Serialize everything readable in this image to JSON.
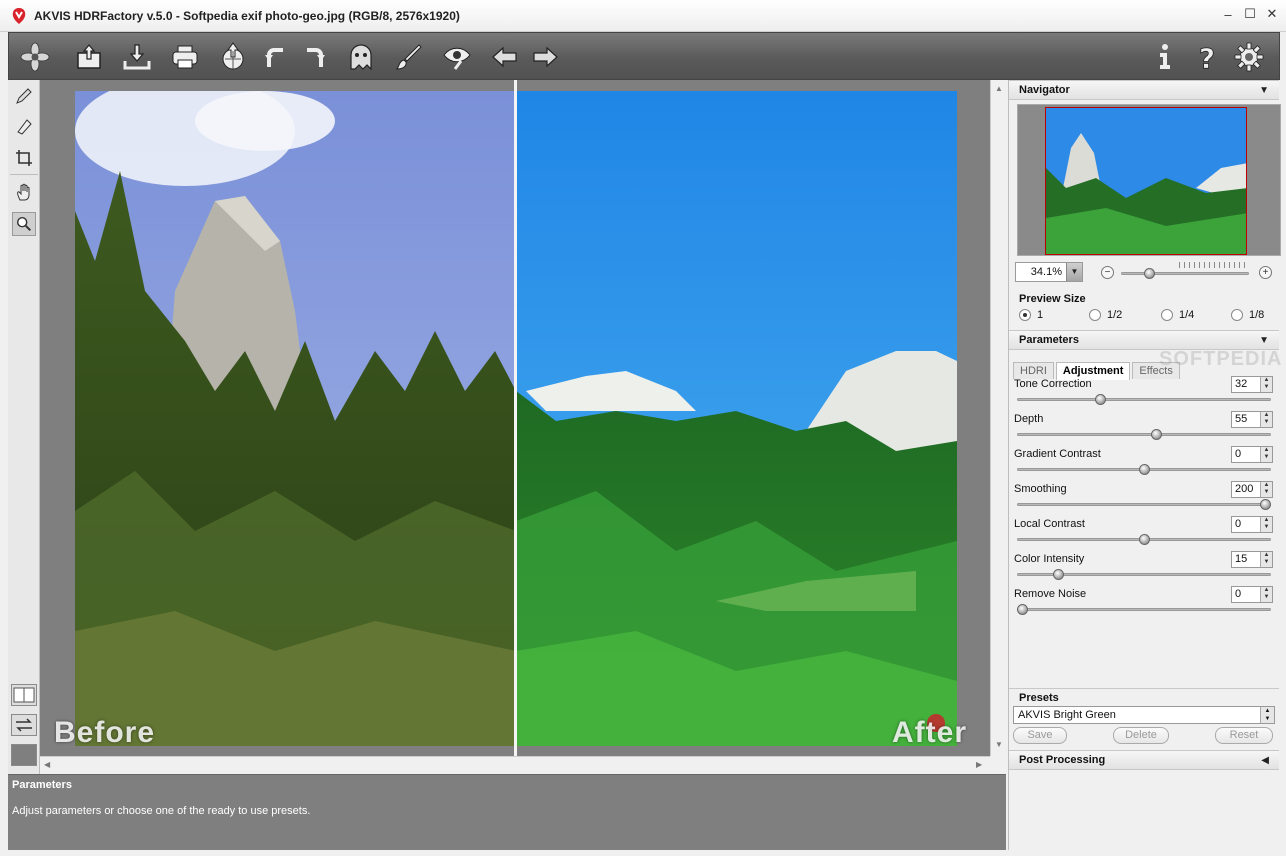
{
  "window": {
    "title": "AKVIS HDRFactory v.5.0 - Softpedia exif photo-geo.jpg (RGB/8, 2576x1920)",
    "controls": {
      "minimize": "–",
      "maximize": "☐",
      "close": "✕"
    }
  },
  "toolbar": {
    "left_icons": [
      "akvis-logo-icon",
      "open-icon",
      "save-icon",
      "print-icon",
      "share-icon",
      "undo-icon",
      "redo-icon",
      "ghost-icon",
      "brush-icon",
      "eye-icon",
      "back-arrow-icon",
      "forward-arrow-icon"
    ],
    "right_icons": [
      "info-icon",
      "help-icon",
      "settings-icon"
    ]
  },
  "canvas": {
    "before_label": "Before",
    "after_label": "After"
  },
  "status": {
    "title": "Parameters",
    "text": "Adjust parameters or choose one of the ready to use presets."
  },
  "navigator": {
    "title": "Navigator",
    "zoom": "34.1%",
    "zoom_level": 0.2
  },
  "preview_size": {
    "title": "Preview Size",
    "options": [
      "1",
      "1/2",
      "1/4",
      "1/8"
    ],
    "selected": "1"
  },
  "parameters": {
    "title": "Parameters",
    "tabs": [
      "HDRI",
      "Adjustment",
      "Effects"
    ],
    "active_tab": "Adjustment",
    "watermark": "SOFTPEDIA",
    "items": [
      {
        "label": "Tone Correction",
        "value": "32",
        "level": 0.32
      },
      {
        "label": "Depth",
        "value": "55",
        "level": 0.55
      },
      {
        "label": "Gradient Contrast",
        "value": "0",
        "level": 0.5
      },
      {
        "label": "Smoothing",
        "value": "200",
        "level": 1.0
      },
      {
        "label": "Local Contrast",
        "value": "0",
        "level": 0.5
      },
      {
        "label": "Color Intensity",
        "value": "15",
        "level": 0.15
      },
      {
        "label": "Remove Noise",
        "value": "0",
        "level": 0.0
      }
    ]
  },
  "presets": {
    "title": "Presets",
    "selected": "AKVIS Bright Green",
    "save_label": "Save",
    "delete_label": "Delete",
    "reset_label": "Reset"
  },
  "post_processing": {
    "title": "Post Processing"
  },
  "colors": {
    "toolbar": "#5a5a5a",
    "canvas_bg": "#7f7f7f",
    "panel_bg": "#f0f0f0"
  }
}
